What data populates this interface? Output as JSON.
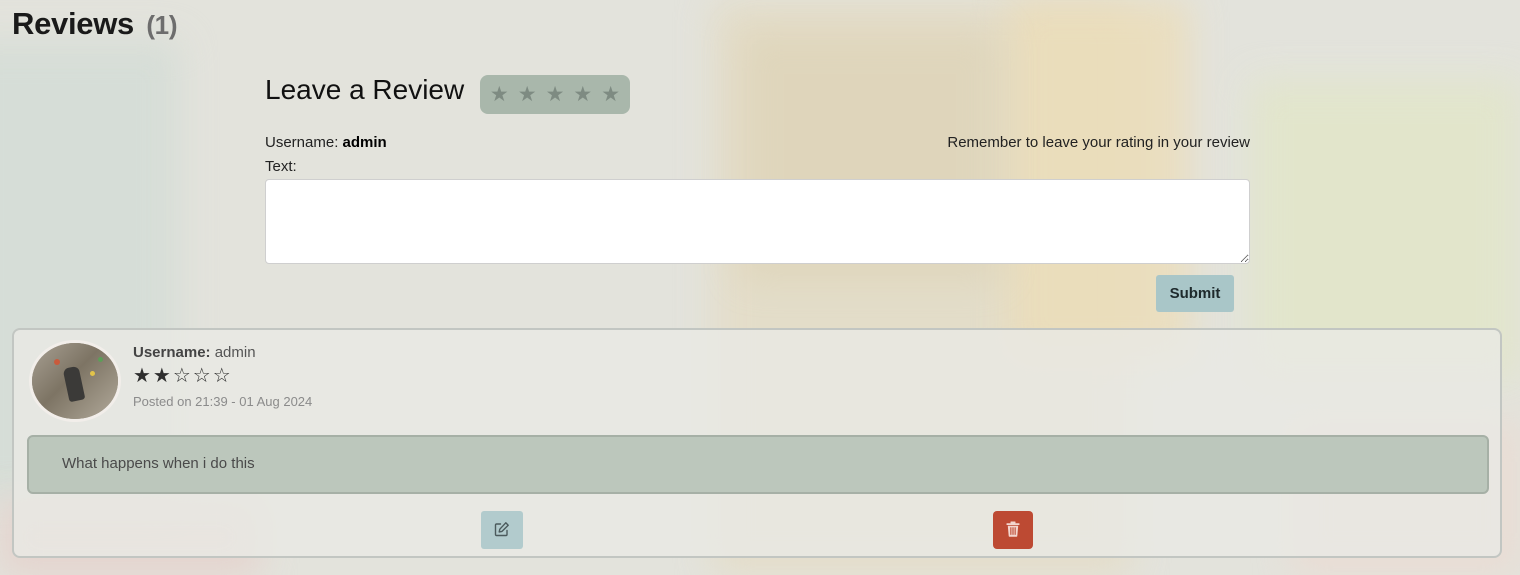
{
  "reviews_header": {
    "title": "Reviews",
    "count": "(1)"
  },
  "review_form": {
    "title": "Leave a Review",
    "rating_picker": {
      "stars": [
        "★",
        "★",
        "★",
        "★",
        "★"
      ],
      "selected": 0
    },
    "username_label": "Username:",
    "username_value": "admin",
    "reminder": "Remember to leave your rating in your review",
    "text_label": "Text:",
    "text_value": "",
    "submit_label": "Submit"
  },
  "reviews": [
    {
      "username_label": "Username:",
      "username": "admin",
      "rating": 2,
      "rating_max": 5,
      "rating_display": "★★☆☆☆",
      "posted": "Posted on 21:39 - 01 Aug 2024",
      "text": "What happens when i do this",
      "edit_icon": "edit-icon",
      "delete_icon": "trash-icon"
    }
  ],
  "colors": {
    "star_picker_bg": "#a9b7ab",
    "submit_bg": "#a9c6c8",
    "edit_bg": "#b2cbcd",
    "delete_bg": "#bd4a33"
  }
}
